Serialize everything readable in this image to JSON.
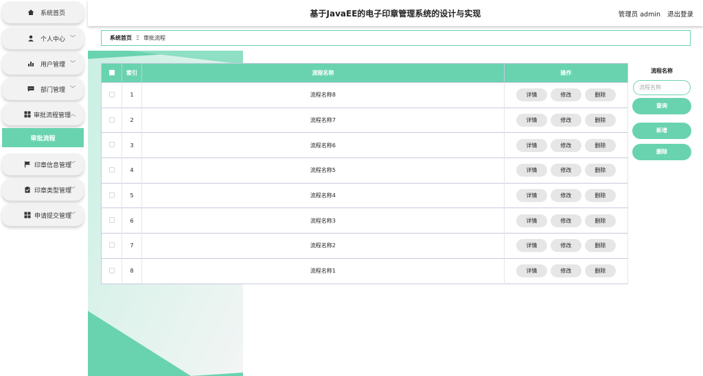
{
  "header": {
    "title": "基于JavaEE的电子印章管理系统的设计与实现",
    "user": "管理员 admin",
    "logout": "退出登录"
  },
  "sidebar": {
    "items": [
      {
        "label": "系统首页",
        "icon": "home-icon"
      },
      {
        "label": "个人中心",
        "icon": "user-icon",
        "chevron": "﹀"
      },
      {
        "label": "用户管理",
        "icon": "bar-chart-icon",
        "chevron": "﹀"
      },
      {
        "label": "部门管理",
        "icon": "chat-icon",
        "chevron": "﹀"
      },
      {
        "label": "审批流程管理",
        "icon": "grid-icon",
        "chevron": "︿"
      },
      {
        "label": "印章信息管理",
        "icon": "flag-icon",
        "chevron": "﹀"
      },
      {
        "label": "印章类型管理",
        "icon": "clipboard-icon",
        "chevron": "﹀"
      },
      {
        "label": "申请提交管理",
        "icon": "grid-icon",
        "chevron": "﹀"
      }
    ],
    "sub_item": "审批流程"
  },
  "breadcrumb": {
    "home": "系统首页",
    "separator": "Ξ",
    "current": "审批流程"
  },
  "table": {
    "headers": {
      "index": "索引",
      "name": "流程名称",
      "actions": "操作"
    },
    "actions": {
      "detail": "详情",
      "edit": "修改",
      "delete": "删除"
    },
    "rows": [
      {
        "index": "1",
        "name": "流程名称8"
      },
      {
        "index": "2",
        "name": "流程名称7"
      },
      {
        "index": "3",
        "name": "流程名称6"
      },
      {
        "index": "4",
        "name": "流程名称5"
      },
      {
        "index": "5",
        "name": "流程名称4"
      },
      {
        "index": "6",
        "name": "流程名称3"
      },
      {
        "index": "7",
        "name": "流程名称2"
      },
      {
        "index": "8",
        "name": "流程名称1"
      }
    ]
  },
  "search": {
    "label": "流程名称",
    "placeholder": "流程名称",
    "query_button": "查询",
    "add_button": "新增",
    "delete_button": "删除"
  },
  "colors": {
    "accent": "#69d3b0",
    "menu_bg": "#f2f2f2",
    "border": "#c7c9dd"
  }
}
